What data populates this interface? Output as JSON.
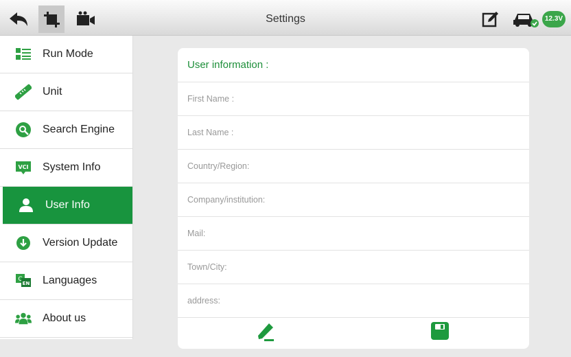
{
  "header": {
    "title": "Settings",
    "voltage": "12.3V",
    "icons": [
      "back-arrow-icon",
      "crop-icon",
      "video-camera-icon",
      "edit-icon",
      "car-status-icon"
    ]
  },
  "sidebar": {
    "items": [
      {
        "label": "Run Mode",
        "icon": "run-mode-icon",
        "active": false
      },
      {
        "label": "Unit",
        "icon": "ruler-icon",
        "active": false
      },
      {
        "label": "Search Engine",
        "icon": "search-engine-icon",
        "active": false
      },
      {
        "label": "System Info",
        "icon": "vci-icon",
        "active": false
      },
      {
        "label": "User Info",
        "icon": "user-icon",
        "active": true
      },
      {
        "label": "Version Update",
        "icon": "download-icon",
        "active": false
      },
      {
        "label": "Languages",
        "icon": "languages-icon",
        "active": false
      },
      {
        "label": "About us",
        "icon": "group-icon",
        "active": false
      }
    ]
  },
  "user_info": {
    "title": "User information :",
    "fields": [
      {
        "label": "First Name :"
      },
      {
        "label": "Last Name :"
      },
      {
        "label": "Country/Region:"
      },
      {
        "label": "Company/institution:"
      },
      {
        "label": "Mail:"
      },
      {
        "label": "Town/City:"
      },
      {
        "label": "address:"
      }
    ]
  },
  "colors": {
    "accent": "#18943e",
    "accent_text": "#1e8f3a",
    "background": "#e9e9e9"
  }
}
